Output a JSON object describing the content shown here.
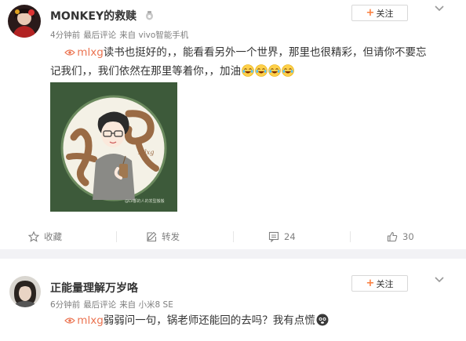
{
  "colors": {
    "accent": "#eb7350",
    "follow_plus": "#fa7d3c",
    "meta_text": "#808080"
  },
  "posts": [
    {
      "username": "MONKEY的救赎",
      "badge_icon": "member-badge-icon",
      "time": "4分钟前",
      "source_label": "最后评论",
      "via": "来自 vivo智能手机",
      "follow_label": "关注",
      "mention": "mlxg",
      "text_line1": "读书也挺好的，，能看看另外一个世界，那里也很精彩，但请你不要忘",
      "text_line2": "记我们，，我们依然在那里等着你，，加油",
      "emoji_count": 4,
      "image": {
        "watermark": "@LV都的人的发型搬搬",
        "signature": "Mlxg"
      },
      "actions": [
        {
          "icon": "star-icon",
          "label": "收藏"
        },
        {
          "icon": "share-icon",
          "label": "转发"
        },
        {
          "icon": "comment-icon",
          "label": "24"
        },
        {
          "icon": "like-icon",
          "label": "30"
        }
      ]
    },
    {
      "username": "正能量理解万岁咯",
      "time": "6分钟前",
      "source_label": "最后评论",
      "via": "来自 小米8 SE",
      "follow_label": "关注",
      "mention": "mlxg",
      "text_line1": "弱弱问一句，锅老师还能回的去吗？我有点慌",
      "emoji_icon": "scared-face-icon"
    }
  ]
}
